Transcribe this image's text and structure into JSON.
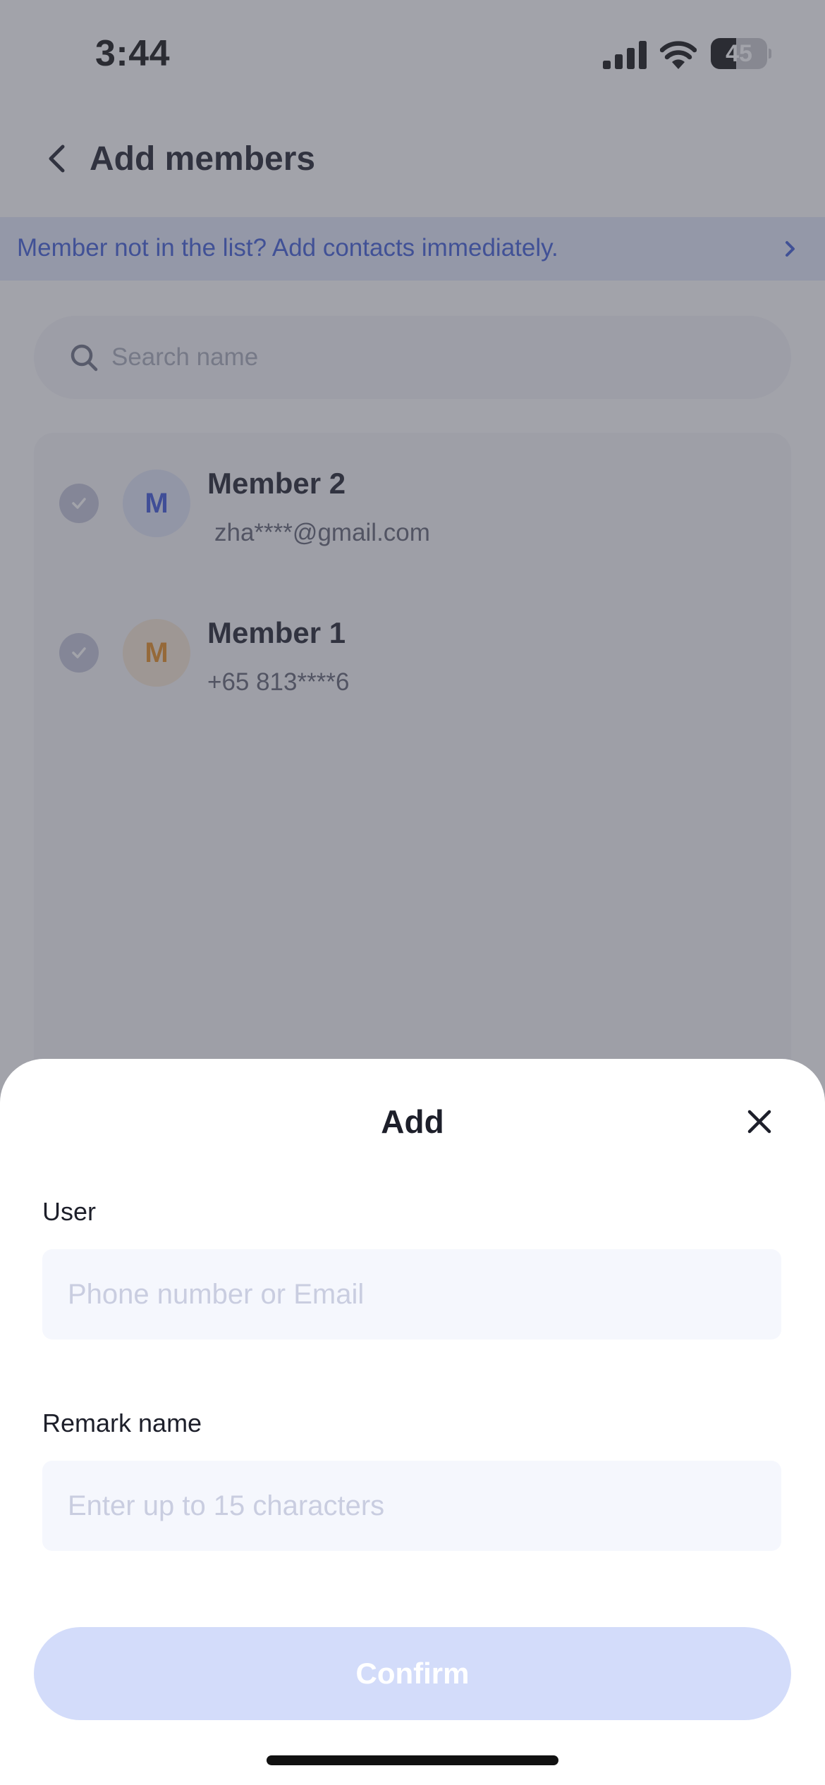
{
  "status_bar": {
    "time": "3:44",
    "battery_level": "45",
    "battery_fraction": 0.45
  },
  "nav": {
    "title": "Add members",
    "back_icon": "chevron-left-icon"
  },
  "banner": {
    "text": "Member not in the list? Add contacts immediately.",
    "icon": "chevron-right-icon",
    "color": "#3c5bd6"
  },
  "search": {
    "placeholder": "Search name",
    "icon": "search-icon"
  },
  "members": [
    {
      "avatar_letter": "M",
      "name": "Member 2",
      "contact": "zha****@gmail.com",
      "selected": true,
      "avatar_color": "#3b55d8"
    },
    {
      "avatar_letter": "M",
      "name": "Member 1",
      "contact": "+65 813****6",
      "selected": true,
      "avatar_color": "#e48b1c"
    }
  ],
  "sheet": {
    "title": "Add",
    "close_icon": "close-icon",
    "user_label": "User",
    "user_placeholder": "Phone number or Email",
    "remark_label": "Remark name",
    "remark_placeholder": "Enter up to 15 characters",
    "confirm_label": "Confirm",
    "confirm_enabled": false,
    "accent_color": "#d3dcfa"
  }
}
